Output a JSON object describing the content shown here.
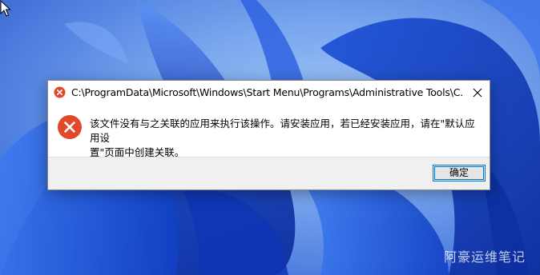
{
  "dialog": {
    "title": "C:\\ProgramData\\Microsoft\\Windows\\Start Menu\\Programs\\Administrative Tools\\C...",
    "message_line1": "该文件没有与之关联的应用来执行该操作。请安装应用，若已经安装应用，请在\"默认应用设",
    "message_line2": "置\"页面中创建关联。",
    "ok_label": "确定"
  },
  "icons": {
    "title": "error-icon",
    "message": "error-icon",
    "close": "close-icon",
    "cursor": "mouse-cursor-icon"
  },
  "colors": {
    "error_red": "#e04a2b",
    "button_border": "#0078d7",
    "footer_bg": "#f0f0f0"
  },
  "watermark": {
    "text": "阿豪运维笔记"
  }
}
